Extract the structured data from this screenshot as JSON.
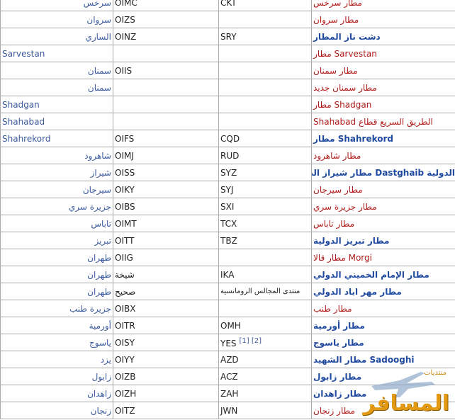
{
  "rows": [
    {
      "city": "سرخس",
      "icao": "OIMC",
      "iata": "CKT",
      "airport": "مطار سرخس",
      "style": "red",
      "city_rtl": true
    },
    {
      "city": "سروان",
      "icao": "OIZS",
      "iata": "",
      "airport": "مطار سروان",
      "style": "red",
      "city_rtl": true
    },
    {
      "city": "الساري",
      "icao": "OINZ",
      "iata": "SRY",
      "airport": "دشت ناز المطار",
      "style": "blue",
      "city_rtl": true
    },
    {
      "city": "Sarvestan",
      "icao": "",
      "iata": "",
      "airport": "Sarvestan مطار",
      "style": "red",
      "city_rtl": false
    },
    {
      "city": "سمنان",
      "icao": "OIIS",
      "iata": "",
      "airport": "مطار سمنان",
      "style": "red",
      "city_rtl": true
    },
    {
      "city": "سمنان",
      "icao": "",
      "iata": "",
      "airport": "مطار سمنان جديد",
      "style": "red",
      "city_rtl": true
    },
    {
      "city": "Shadgan",
      "icao": "",
      "iata": "",
      "airport": "Shadgan مطار",
      "style": "red",
      "city_rtl": false
    },
    {
      "city": "Shahabad",
      "icao": "",
      "iata": "",
      "airport": "الطريق السريع قطاع Shahabad",
      "style": "red",
      "city_rtl": false
    },
    {
      "city": "Shahrekord",
      "icao": "OIFS",
      "iata": "CQD",
      "airport": "Shahrekord مطار",
      "style": "blue",
      "city_rtl": false
    },
    {
      "city": "شاهرود",
      "icao": "OIMJ",
      "iata": "RUD",
      "airport": "مطار شاهرود",
      "style": "red",
      "city_rtl": true
    },
    {
      "city": "شيراز",
      "icao": "OISS",
      "iata": "SYZ",
      "airport": "الدولية Dastghaib مطار شيراز الدولي (شهيد",
      "style": "blue",
      "city_rtl": true
    },
    {
      "city": "سيرجان",
      "icao": "OIKY",
      "iata": "SYJ",
      "airport": "مطار سيرجان",
      "style": "red",
      "city_rtl": true
    },
    {
      "city": "جزيرة سري",
      "icao": "OIBS",
      "iata": "SXI",
      "airport": "مطار جزيرة سري",
      "style": "red",
      "city_rtl": true
    },
    {
      "city": "تاباس",
      "icao": "OIMT",
      "iata": "TCX",
      "airport": "مطار تاباس",
      "style": "red",
      "city_rtl": true
    },
    {
      "city": "تبريز",
      "icao": "OITT",
      "iata": "TBZ",
      "airport": "مطار تبريز الدولية",
      "style": "blue",
      "city_rtl": true
    },
    {
      "city": "طهران",
      "icao": "OIIG",
      "iata": "",
      "airport": "Morgi مطار قالا",
      "style": "red",
      "city_rtl": true
    },
    {
      "city": "طهران",
      "icao": "شيخة",
      "iata": "IKA",
      "airport": "مطار الإمام الخميني الدولي",
      "style": "blue",
      "city_rtl": true
    },
    {
      "city": "طهران",
      "icao": "صحيح",
      "iata": "منتدى المجالس الرومانسية",
      "airport": "مطار مهر اباد الدولي",
      "style": "blue",
      "city_rtl": true
    },
    {
      "city": "جزيرة طنب",
      "icao": "OIBX",
      "iata": "",
      "airport": "مطار طنب",
      "style": "red",
      "city_rtl": true
    },
    {
      "city": "أورمية",
      "icao": "OITR",
      "iata": "OMH",
      "airport": "مطار أورمية",
      "style": "blue",
      "city_rtl": true
    },
    {
      "city": "ياسوج",
      "icao": "OISY",
      "iata": "YES",
      "airport": "مطار ياسوج",
      "style": "blue",
      "city_rtl": true,
      "refs": "[1] [2]"
    },
    {
      "city": "يزد",
      "icao": "OIYY",
      "iata": "AZD",
      "airport": "Sadooghi مطار الشهيد",
      "style": "blue",
      "city_rtl": true
    },
    {
      "city": "زابول",
      "icao": "OIZB",
      "iata": "ACZ",
      "airport": "مطار زابول",
      "style": "blue",
      "city_rtl": true
    },
    {
      "city": "زاهدان",
      "icao": "OIZH",
      "iata": "ZAH",
      "airport": "مطار زاهدان",
      "style": "blue",
      "city_rtl": true
    },
    {
      "city": "زنجان",
      "icao": "OITZ",
      "iata": "JWN",
      "airport": "مطار زنجان",
      "style": "red",
      "city_rtl": true
    }
  ],
  "watermark": {
    "text": "المسافر",
    "subtext": "منتديات"
  }
}
